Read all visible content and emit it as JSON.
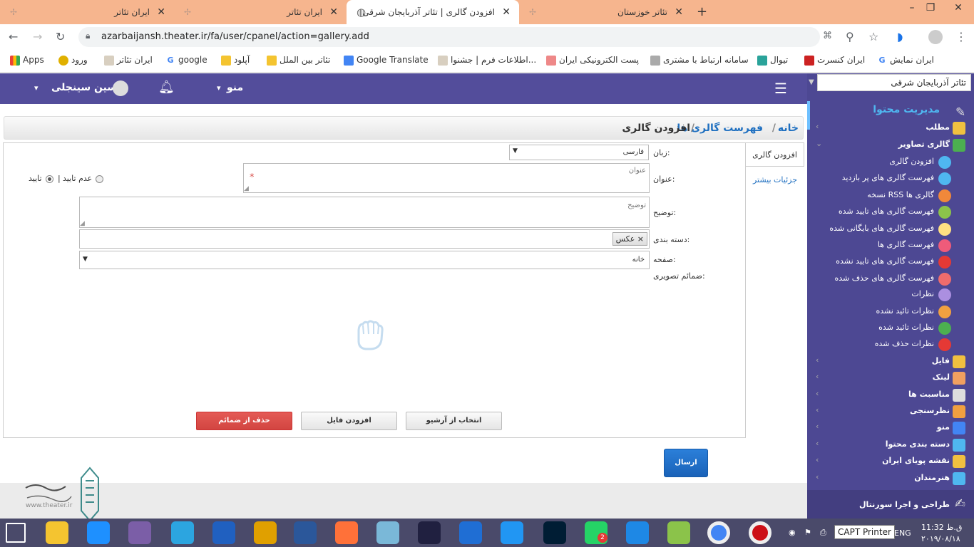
{
  "browser": {
    "tabs": [
      {
        "title": "ایران تئاتر",
        "active": false
      },
      {
        "title": "ایران تئاتر",
        "active": false
      },
      {
        "title": "افزودن گالری | تئاتر آذربایجان شرقی",
        "active": true
      },
      {
        "title": "تئاتر خوزستان",
        "active": false
      }
    ],
    "new_tab": "+",
    "window_controls": {
      "minimize": "–",
      "maximize": "❐",
      "close": "✕"
    },
    "url": "azarbaijansh.theater.ir/fa/user/cpanel/action=gallery.add",
    "bookmarks": [
      {
        "label": "Apps",
        "color": "#4285f4"
      },
      {
        "label": "ورود",
        "color": "#e0b000"
      },
      {
        "label": "ایران تئاتر",
        "color": "#b0a090"
      },
      {
        "label": "google",
        "color": "#4285f4"
      },
      {
        "label": "آپلود",
        "color": "#f4c430"
      },
      {
        "label": "تئاتر بین الملل",
        "color": "#f4c430"
      },
      {
        "label": "Google Translate",
        "color": "#4285f4"
      },
      {
        "label": "اطلاعات فرم | جشنوا...",
        "color": "#b0a090"
      },
      {
        "label": "پست الکترونیکی ایران",
        "color": "#cc3333"
      },
      {
        "label": "سامانه ارتباط با مشتری",
        "color": "#888888"
      },
      {
        "label": "تیوال",
        "color": "#2aa39a"
      },
      {
        "label": "ایران کنسرت",
        "color": "#cc2222"
      },
      {
        "label": "ایران نمایش",
        "color": "#4285f4"
      }
    ]
  },
  "header": {
    "user_name": "حسین سینجلی",
    "menu_label": "منو",
    "chevron": "⌄"
  },
  "sidebar": {
    "site_select": "تئاتر آذربایجان شرقی",
    "heading": "مدیریت محتوا",
    "items": [
      {
        "label": "مطلب",
        "icon": "document-icon",
        "color": "#f0c040",
        "sub": false
      },
      {
        "label": "گالری تصاویر",
        "icon": "gallery-icon",
        "color": "#4caf50",
        "sub": false,
        "open": true
      },
      {
        "label": "افزودن گالری",
        "icon": "plus-circle-icon",
        "color": "#4fb7f0",
        "sub": true
      },
      {
        "label": "فهرست گالری های پر بازدید",
        "icon": "trend-icon",
        "color": "#4fb7f0",
        "sub": true
      },
      {
        "label": "نسخه RSS گالری ها",
        "icon": "rss-icon",
        "color": "#f0883a",
        "sub": true
      },
      {
        "label": "فهرست گالری های تایید شده",
        "icon": "check-icon",
        "color": "#8bc34a",
        "sub": true
      },
      {
        "label": "فهرست گالری های بایگانی شده",
        "icon": "archive-icon",
        "color": "#ffe082",
        "sub": true
      },
      {
        "label": "فهرست گالری ها",
        "icon": "list-icon",
        "color": "#ef5b7a",
        "sub": true
      },
      {
        "label": "فهرست گالری های تایید نشده",
        "icon": "ban-icon",
        "color": "#e53935",
        "sub": true
      },
      {
        "label": "فهرست گالری های حذف شده",
        "icon": "trash-icon",
        "color": "#ef6c6c",
        "sub": true
      },
      {
        "label": "نظرات",
        "icon": "comments-icon",
        "color": "#ab8fe0",
        "sub": true
      },
      {
        "label": "نظرات تائید نشده",
        "icon": "comment-pending-icon",
        "color": "#f0a040",
        "sub": true
      },
      {
        "label": "نظرات تائید شده",
        "icon": "comment-approved-icon",
        "color": "#4caf50",
        "sub": true
      },
      {
        "label": "نظرات حذف شده",
        "icon": "comment-deleted-icon",
        "color": "#e53935",
        "sub": true
      },
      {
        "label": "فایل",
        "icon": "folder-icon",
        "color": "#f0c040",
        "sub": false
      },
      {
        "label": "لینک",
        "icon": "link-icon",
        "color": "#f0a060",
        "sub": false
      },
      {
        "label": "مناسبت ها",
        "icon": "calendar-icon",
        "color": "#dddddd",
        "sub": false
      },
      {
        "label": "نظرسنجی",
        "icon": "poll-icon",
        "color": "#f0a040",
        "sub": false
      },
      {
        "label": "منو",
        "icon": "menu-icon",
        "color": "#4285f4",
        "sub": false
      },
      {
        "label": "دسته بندی محتوا",
        "icon": "category-icon",
        "color": "#4fb7f0",
        "sub": false
      },
      {
        "label": "نقشه پویای ایران",
        "icon": "map-pin-icon",
        "color": "#f0c040",
        "sub": false
      },
      {
        "label": "هنرمندان",
        "icon": "artist-icon",
        "color": "#4fb7f0",
        "sub": false
      }
    ],
    "footer": "طراحی و اجرا سورنتال"
  },
  "breadcrumb": {
    "home": "خانه",
    "list": "فهرست گالری ها",
    "current": "افزودن گالری",
    "sep": "/"
  },
  "side_tabs": {
    "add": "افزودن گالری",
    "details": "جزئیات بیشتر"
  },
  "form": {
    "language_label": "زبان:",
    "language_value": "فارسی",
    "title_label": "عنوان:",
    "title_placeholder": "عنوان",
    "required_mark": "*",
    "approve_label": "تایید",
    "disapprove_label": "عدم تایید",
    "description_label": "توضیح:",
    "description_placeholder": "توضیح",
    "category_label": "دسته بندی:",
    "category_tag": "عکس",
    "tag_remove": "×",
    "page_label": "صفحه:",
    "page_value": "خانه",
    "attachments_label": "ضمائم تصویری:",
    "archive_button": "انتخاب از آرشیو",
    "add_file_button": "افزودن فایل",
    "delete_button": "حذف از ضمائم",
    "submit_button": "ارسال"
  },
  "watermark": {
    "site": "www.theater.ir"
  },
  "taskbar": {
    "printer": "CAPT Printer",
    "lang": "ENG",
    "time": "11:32 ق.ظ",
    "date": "۲۰۱۹/۰۸/۱۸",
    "whatsapp_badge": "2",
    "apps": [
      {
        "name": "start-icon",
        "color": "#ffffff"
      },
      {
        "name": "file-explorer-icon",
        "color": "#f4c430"
      },
      {
        "name": "ie-icon",
        "color": "#1e90ff"
      },
      {
        "name": "visual-studio-icon",
        "color": "#7b5ea7"
      },
      {
        "name": "telegram-icon",
        "color": "#2ca5e0"
      },
      {
        "name": "shield-icon",
        "color": "#2060c0"
      },
      {
        "name": "winamp-icon",
        "color": "#e0a000"
      },
      {
        "name": "word-icon",
        "color": "#2b579a"
      },
      {
        "name": "firefox-icon",
        "color": "#ff7139"
      },
      {
        "name": "notepad-icon",
        "color": "#7ab8d8"
      },
      {
        "name": "pen-icon",
        "color": "#202040"
      },
      {
        "name": "app-icon",
        "color": "#1f6ed4"
      },
      {
        "name": "share-icon",
        "color": "#2196f3"
      },
      {
        "name": "photoshop-icon",
        "color": "#001d34"
      },
      {
        "name": "whatsapp-icon",
        "color": "#25d366"
      },
      {
        "name": "wifi-icon",
        "color": "#1e88e5"
      },
      {
        "name": "paint-icon",
        "color": "#8bc34a"
      },
      {
        "name": "chrome-icon",
        "color": "#4285f4"
      },
      {
        "name": "opera-icon",
        "color": "#cc0f16"
      }
    ]
  }
}
